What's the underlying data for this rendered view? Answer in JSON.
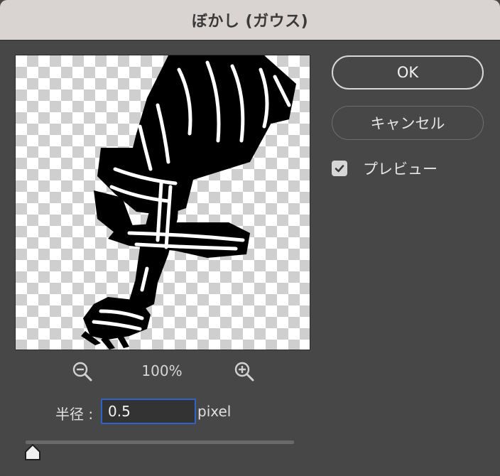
{
  "window": {
    "title": "ぼかし (ガウス)"
  },
  "buttons": {
    "ok_label": "OK",
    "cancel_label": "キャンセル"
  },
  "preview": {
    "label": "プレビュー",
    "checked": true
  },
  "zoom": {
    "value": "100%",
    "zoom_out_icon": "zoom-out-magnifier",
    "zoom_in_icon": "zoom-in-magnifier"
  },
  "radius": {
    "label": "半径 :",
    "value": "0.5",
    "unit": "pixel"
  },
  "slider": {
    "value": "0.5"
  },
  "colors": {
    "dialog_bg": "#474747",
    "titlebar_bg": "#d9d3d1",
    "input_focus_border": "#2f63c8"
  }
}
